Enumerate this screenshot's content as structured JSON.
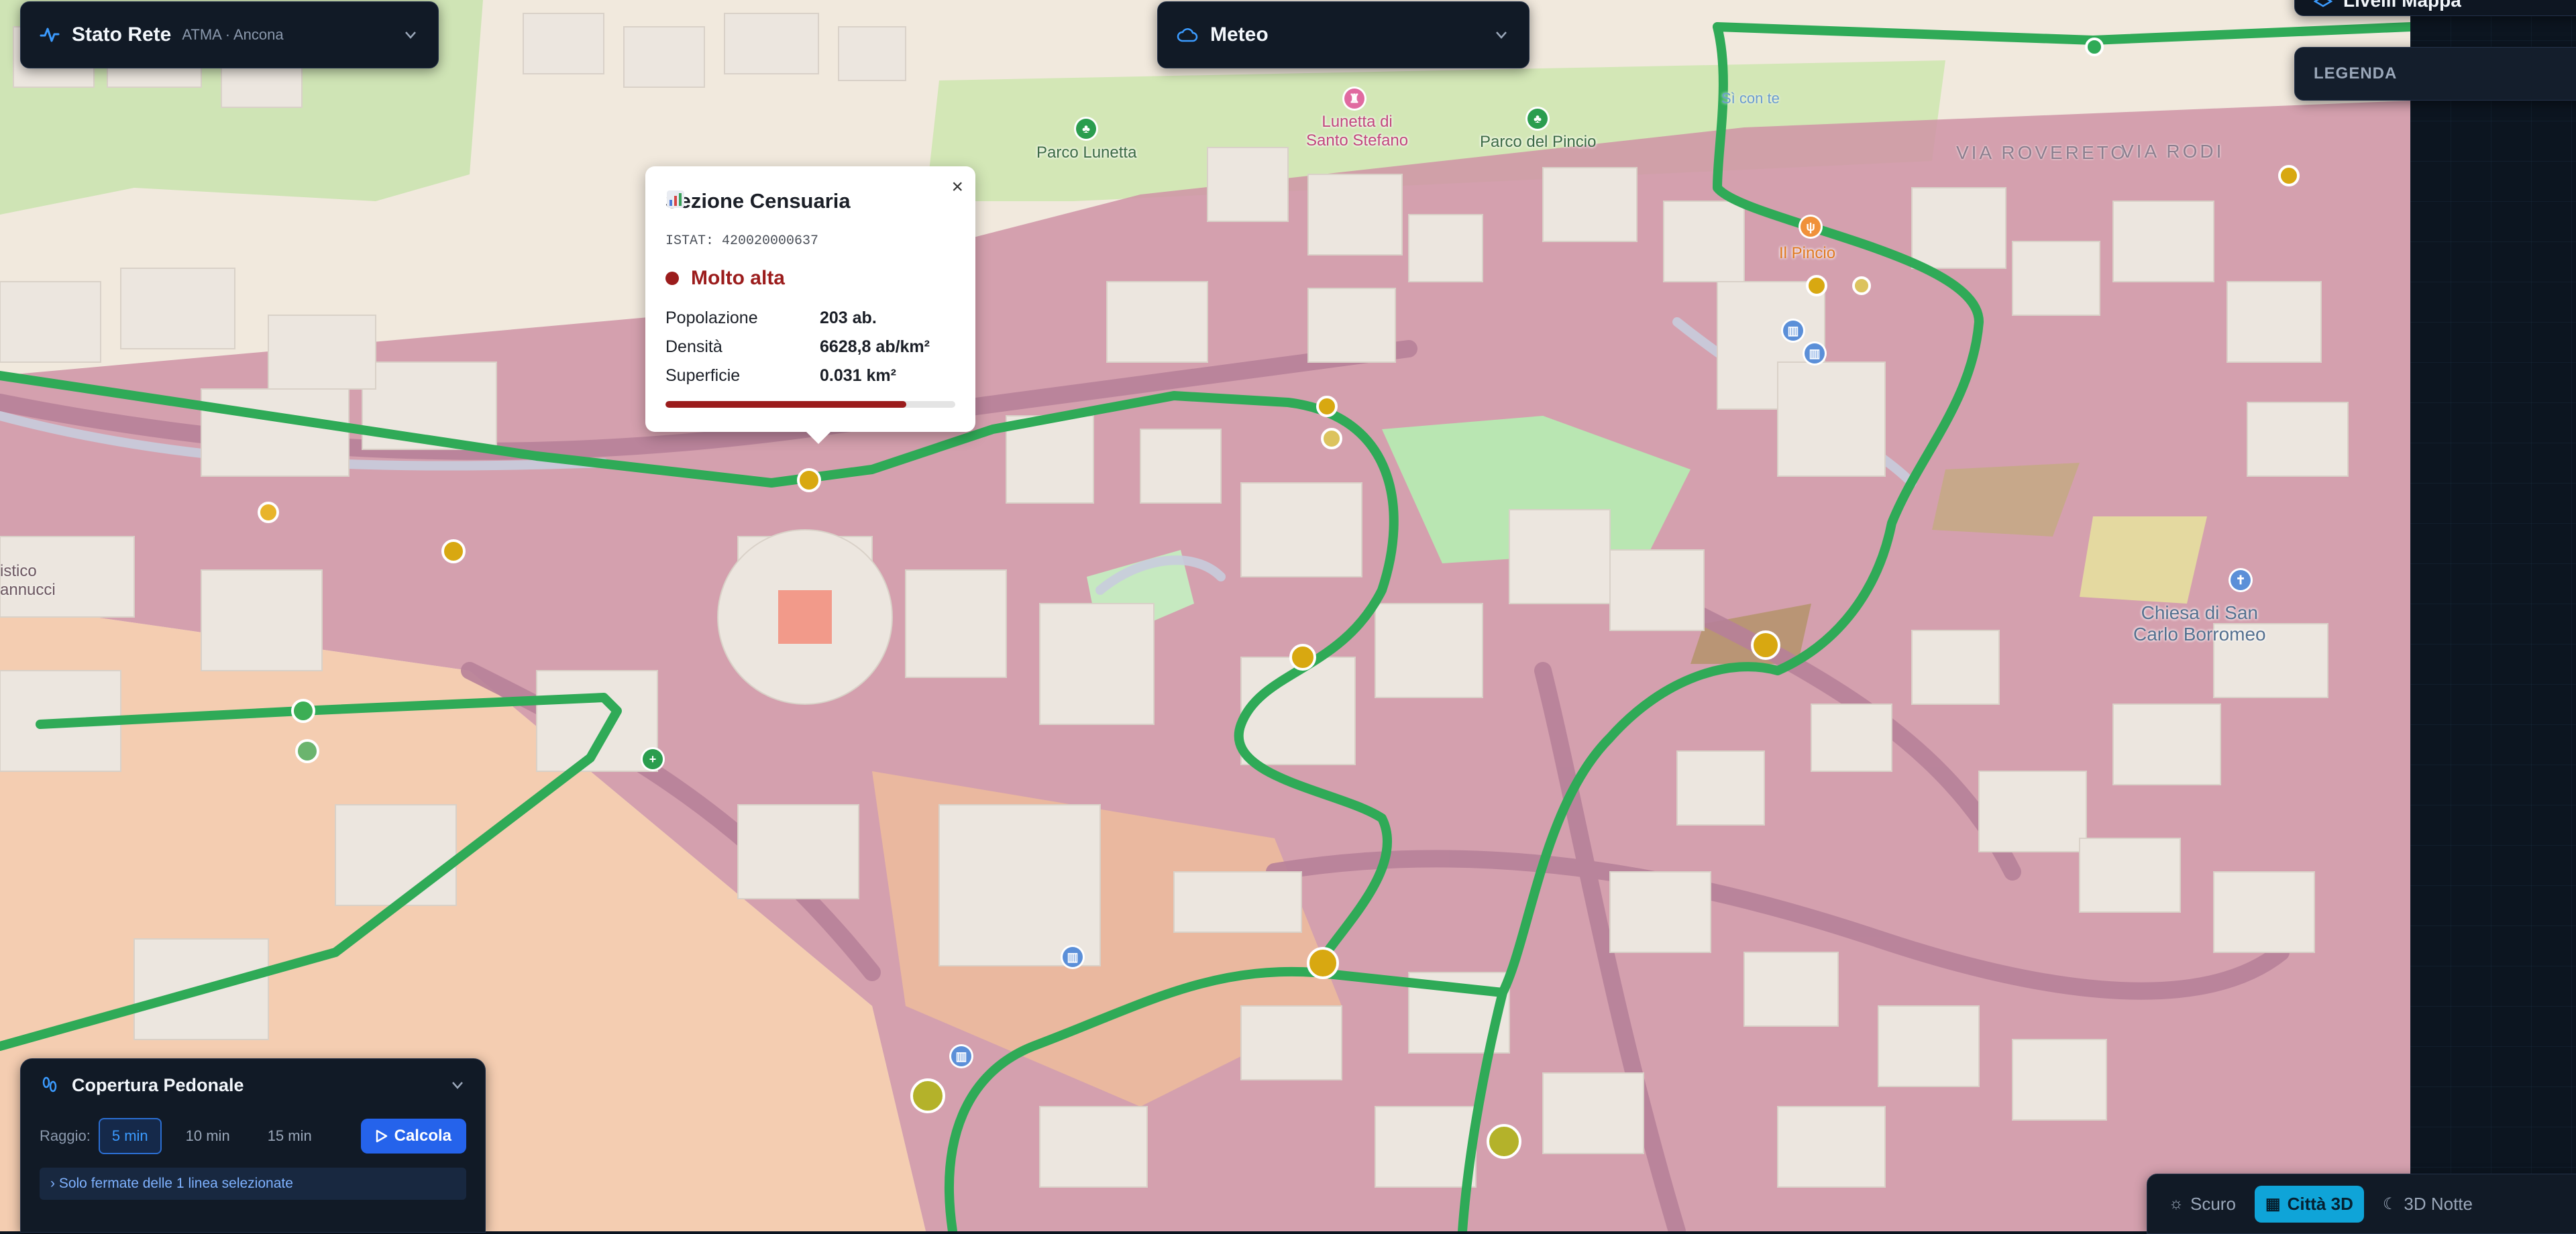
{
  "stato_rete": {
    "title": "Stato Rete",
    "subtitle": "ATMA · Ancona"
  },
  "meteo": {
    "title": "Meteo"
  },
  "livelli": {
    "title": "Livelli Mappa"
  },
  "legenda": {
    "title": "LEGENDA"
  },
  "popup": {
    "title": "Sezione Censuaria",
    "istat": "ISTAT: 420020000637",
    "level": "Molto alta",
    "level_color": "#9b1c1c",
    "rows": [
      {
        "key": "Popolazione",
        "value": "203 ab."
      },
      {
        "key": "Densità",
        "value": "6628,8 ab/km²"
      },
      {
        "key": "Superficie",
        "value": "0.031 km²"
      }
    ],
    "bar_fraction": 0.83,
    "close": "×"
  },
  "map_labels": {
    "parco_lunetta": "Parco Lunetta",
    "lunetta": "Lunetta di\nSanto Stefano",
    "parco_pincio": "Parco del Pincio",
    "via_rovereto": "VIA ROVERETO",
    "via_rodi": "VIA RODI",
    "il_pincio": "Il Pincio",
    "chiesa": "Chiesa di San\nCarlo Borromeo",
    "si_con_te": "Sì con te",
    "left_edge": "istico\nannucci"
  },
  "copertura": {
    "title": "Copertura Pedonale",
    "raggio_label": "Raggio:",
    "options": [
      "5 min",
      "10 min",
      "15 min"
    ],
    "selected": "5 min",
    "calc_label": "Calcola",
    "note": "Solo fermate delle 1 linea selezionate"
  },
  "themes": [
    {
      "label": "Scuro",
      "icon": "sun-icon",
      "active": false
    },
    {
      "label": "Città 3D",
      "icon": "building-icon",
      "active": true
    },
    {
      "label": "3D Notte",
      "icon": "moon-icon",
      "active": false
    }
  ],
  "colors": {
    "route": "#2faa57",
    "stop": "#d8a811",
    "zone_high": "#cf93a6",
    "building": "#ece6df",
    "panel": "#111a26",
    "accent": "#2563eb"
  }
}
